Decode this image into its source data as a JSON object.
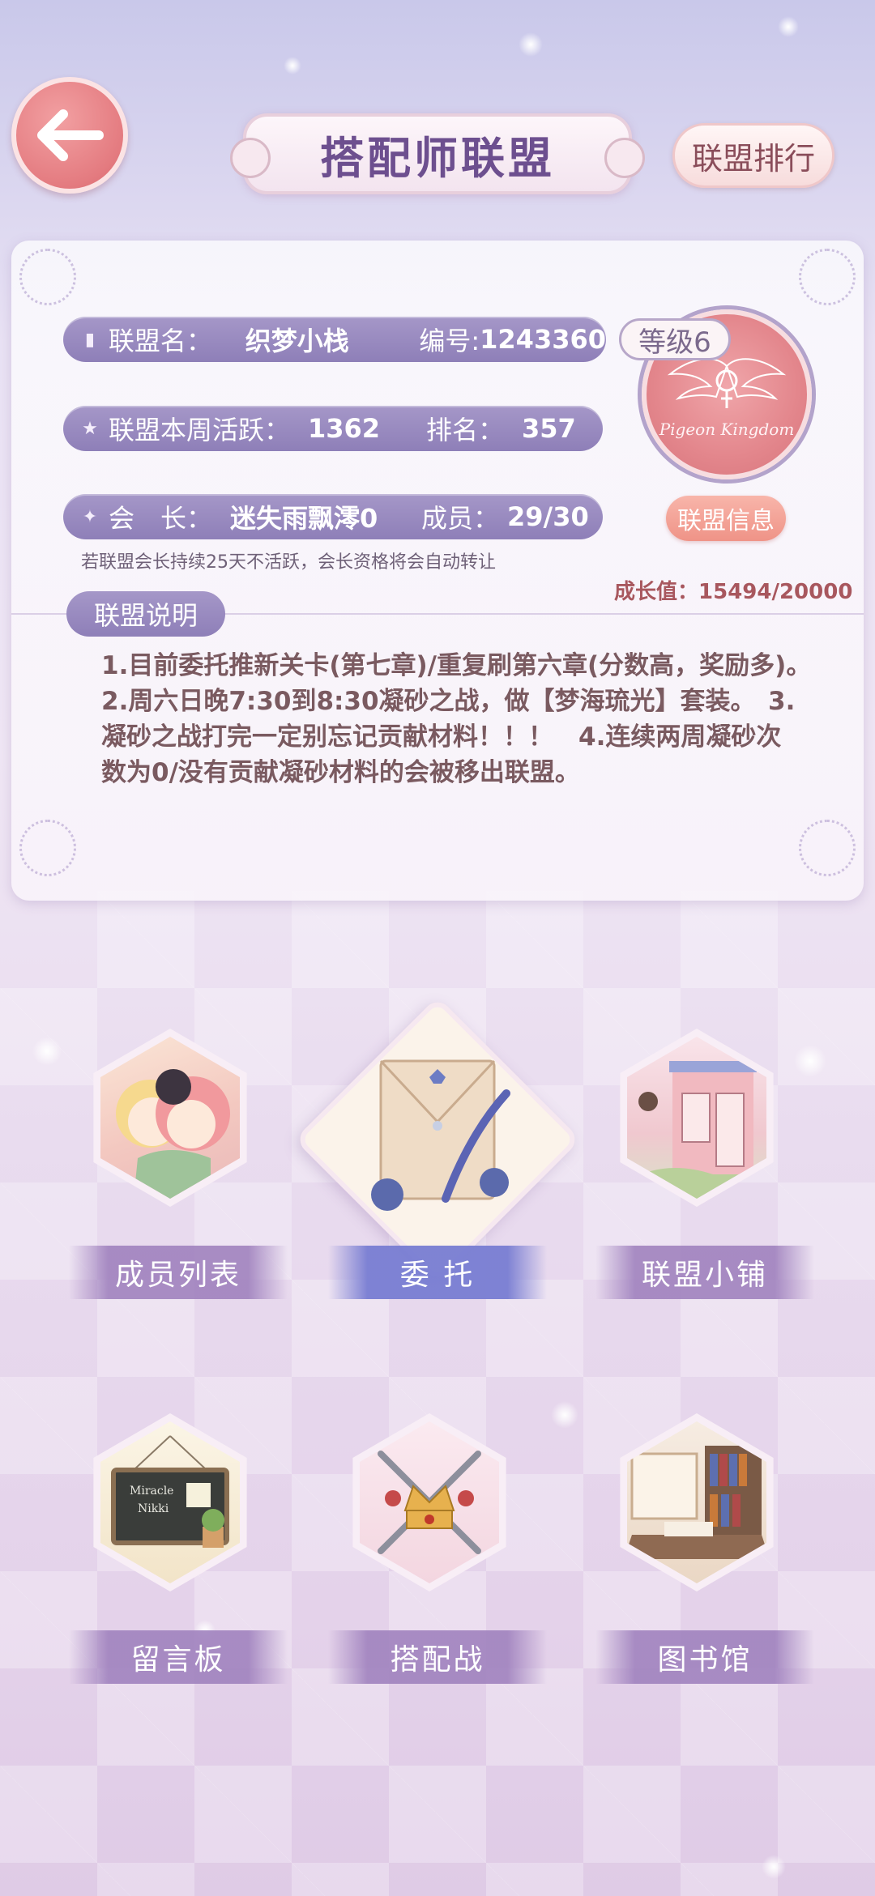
{
  "header": {
    "title": "搭配师联盟",
    "rank_button": "联盟排行"
  },
  "alliance": {
    "name_label": "联盟名：",
    "name": "织梦小栈",
    "id_label": "编号:",
    "id": "1243360",
    "level": "等级6",
    "activity_label": "联盟本周活跃：",
    "activity": "1362",
    "rank_label": "排名：",
    "rank": "357",
    "leader_label": "会　长：",
    "leader": "迷失雨飘澪0",
    "members_label": "成员：",
    "members": "29/30",
    "info_button": "联盟信息",
    "emblem_text": "Pigeon Kingdom",
    "warning": "若联盟会长持续25天不活跃，会长资格将会自动转让",
    "growth_label": "成长值：",
    "growth": "15494/20000"
  },
  "description": {
    "tag": "联盟说明",
    "text": "1.目前委托推新关卡(第七章)/重复刷第六章(分数高，奖励多)。　2.周六日晚7:30到8:30凝砂之战，做【梦海琉光】套装。　3.凝砂之战打完一定别忘记贡献材料！！！　4.连续两周凝砂次数为0/没有贡献凝砂材料的会被移出联盟。"
  },
  "tiles": [
    {
      "label": "成员列表"
    },
    {
      "label": "委 托"
    },
    {
      "label": "联盟小铺"
    },
    {
      "label": "留言板"
    },
    {
      "label": "搭配战"
    },
    {
      "label": "图书馆"
    }
  ],
  "board_text": {
    "line1": "Miracle",
    "line2": "Nikki"
  },
  "colors": {
    "accent_purple": "#8e7fb8",
    "back_button": "#e47b80",
    "emblem": "#e3868c",
    "growth_text": "#a8575e",
    "desc_text": "#7a5a60"
  }
}
